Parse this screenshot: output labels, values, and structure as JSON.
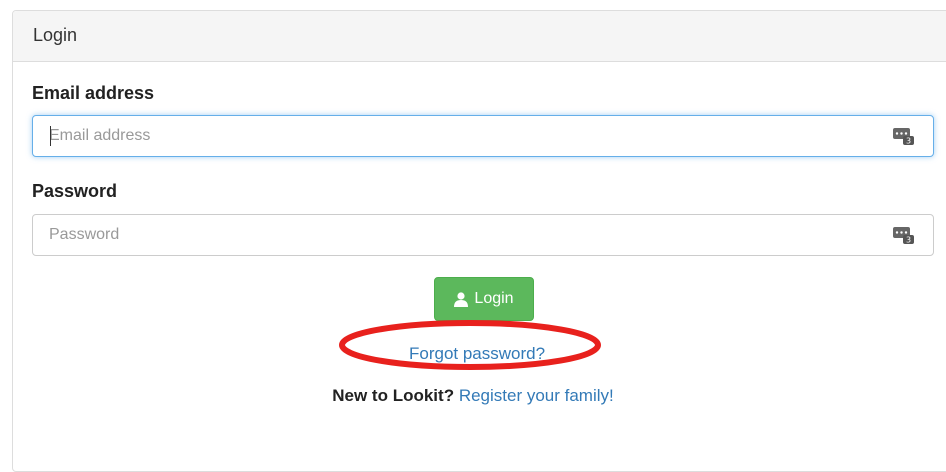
{
  "panel": {
    "title": "Login"
  },
  "email": {
    "label": "Email address",
    "placeholder": "Email address",
    "value": ""
  },
  "password": {
    "label": "Password",
    "placeholder": "Password",
    "value": ""
  },
  "login_button": {
    "label": "Login",
    "icon": "user-icon"
  },
  "forgot_password": {
    "label": "Forgot password?"
  },
  "register": {
    "prompt": "New to Lookit?",
    "link_label": "Register your family!"
  },
  "colors": {
    "primary_link": "#337ab7",
    "success_button": "#5cb85c",
    "annotation_ellipse": "#e8211d",
    "focus_border": "#66afe9"
  }
}
